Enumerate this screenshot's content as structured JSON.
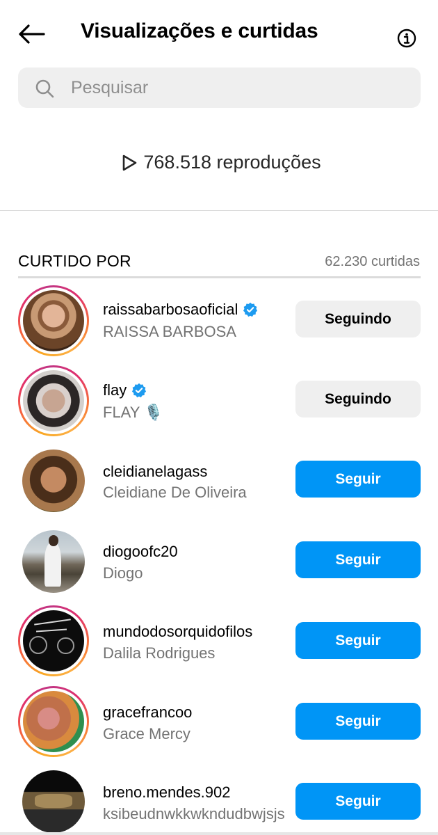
{
  "header": {
    "title": "Visualizações e curtidas",
    "back_icon": "arrow-left-icon",
    "info_icon": "info-icon"
  },
  "search": {
    "placeholder": "Pesquisar",
    "value": ""
  },
  "plays": {
    "text": "768.518 reproduções",
    "icon": "play-icon"
  },
  "liked_by": {
    "title": "CURTIDO POR",
    "count": "62.230 curtidas"
  },
  "colors": {
    "follow_blue": "#0095f6",
    "following_gray": "#efefef",
    "verified_blue": "#1d9bf0",
    "secondary_text": "#737373"
  },
  "users": [
    {
      "username": "raissabarbosaoficial",
      "fullname": "RAISSA BARBOSA",
      "verified": true,
      "story_ring": true,
      "button": "Seguindo"
    },
    {
      "username": "flay",
      "fullname": "FLAY 🎙️",
      "verified": true,
      "story_ring": true,
      "button": "Seguindo"
    },
    {
      "username": "cleidianelagass",
      "fullname": "Cleidiane De Oliveira",
      "verified": false,
      "story_ring": false,
      "button": "Seguir"
    },
    {
      "username": "diogoofc20",
      "fullname": "Diogo",
      "verified": false,
      "story_ring": false,
      "button": "Seguir"
    },
    {
      "username": "mundodosorquidofilos",
      "fullname": "Dalila Rodrigues",
      "verified": false,
      "story_ring": true,
      "button": "Seguir"
    },
    {
      "username": "gracefrancoo",
      "fullname": "Grace Mercy",
      "verified": false,
      "story_ring": true,
      "button": "Seguir"
    },
    {
      "username": "breno.mendes.902",
      "fullname": "ksibeudnwkkwkndudbwjsjs",
      "verified": false,
      "story_ring": false,
      "button": "Seguir"
    }
  ]
}
